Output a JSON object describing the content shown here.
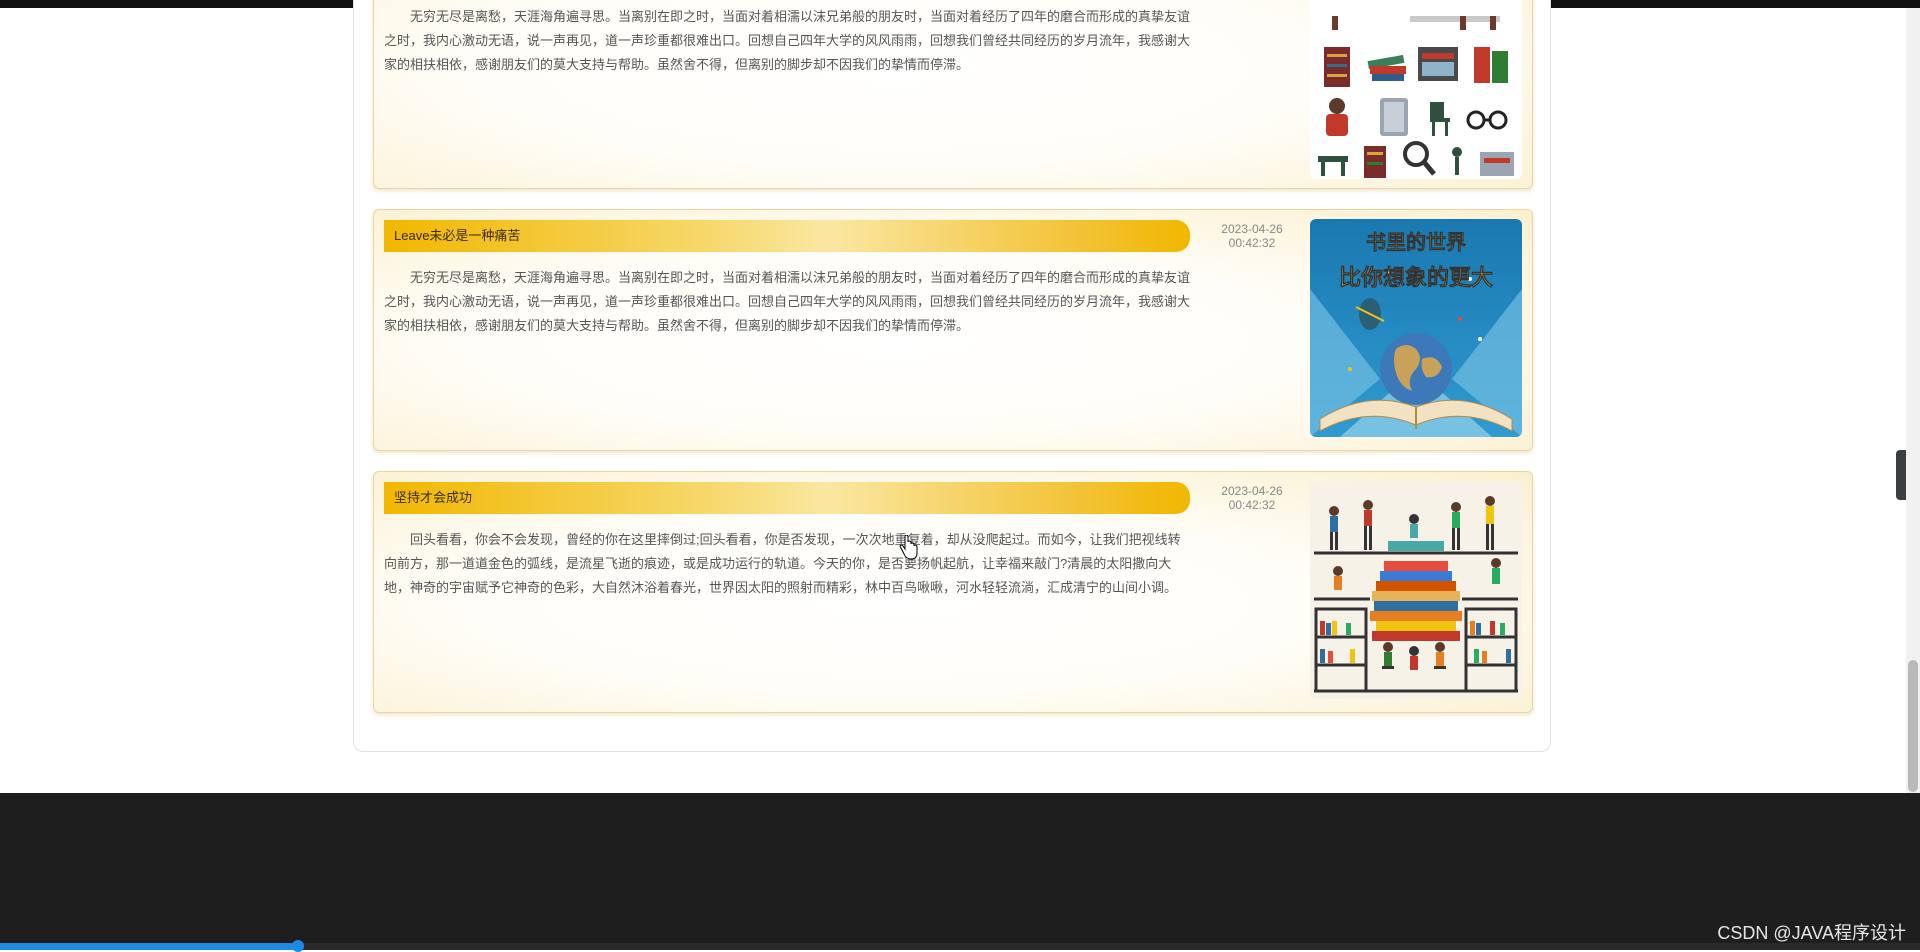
{
  "articles": [
    {
      "title": "",
      "date": "",
      "time": "",
      "body": "无穷无尽是离愁，天涯海角遍寻思。当离别在即之时，当面对着相濡以沫兄弟般的朋友时，当面对着经历了四年的磨合而形成的真挚友谊之时，我内心激动无语，说一声再见，道一声珍重都很难出口。回想自己四年大学的风风雨雨，回想我们曾经共同经历的岁月流年，我感谢大家的相扶相依，感谢朋友们的莫大支持与帮助。虽然舍不得，但离别的脚步却不因我们的挚情而停滞。",
      "image_icon": "library-icons-illustration"
    },
    {
      "title": "Leave未必是一种痛苦",
      "date": "2023-04-26",
      "time": "00:42:32",
      "body": "无穷无尽是离愁，天涯海角遍寻思。当离别在即之时，当面对着相濡以沫兄弟般的朋友时，当面对着经历了四年的磨合而形成的真挚友谊之时，我内心激动无语，说一声再见，道一声珍重都很难出口。回想自己四年大学的风风雨雨，回想我们曾经共同经历的岁月流年，我感谢大家的相扶相依，感谢朋友们的莫大支持与帮助。虽然舍不得，但离别的脚步却不因我们的挚情而停滞。",
      "image_line1": "书里的世界",
      "image_line2": "比你想象的更大",
      "image_icon": "book-world-poster"
    },
    {
      "title": "坚持才会成功",
      "date": "2023-04-26",
      "time": "00:42:32",
      "body": "回头看看，你会不会发现，曾经的你在这里摔倒过;回头看看，你是否发现，一次次地重复着，却从没爬起过。而如今，让我们把视线转向前方，那一道道金色的弧线，是流星飞逝的痕迹，或是成功运行的轨道。今天的你，是否要扬帆起航，让幸福来敲门?清晨的太阳撒向大地，神奇的宇宙赋予它神奇的色彩，大自然沐浴着春光，世界因太阳的照射而精彩，林中百鸟啾啾，河水轻轻流淌，汇成清宁的山间小调。",
      "image_icon": "readers-on-books-illustration"
    }
  ],
  "watermark": "CSDN @JAVA程序设计",
  "side_toggle_icon": "chevron-left-icon",
  "colors": {
    "title_bar_gold": "#f1b700",
    "footer": "#1e1e1e",
    "progress": "#1e88e5"
  }
}
